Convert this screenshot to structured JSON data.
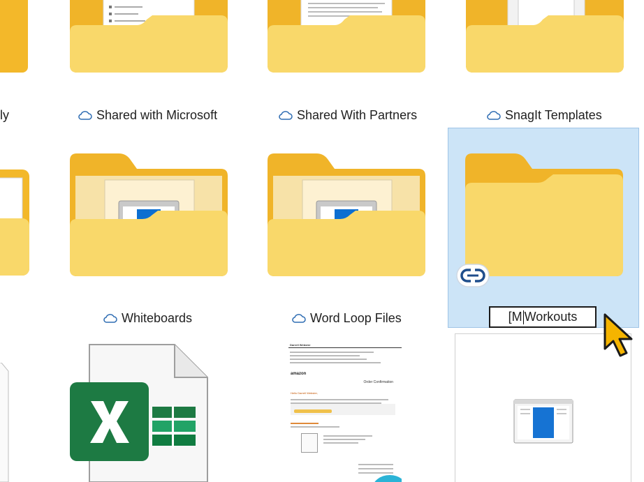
{
  "labels": {
    "partial_left_1": "ly",
    "shared_with_microsoft": "Shared with Microsoft",
    "shared_with_partners": "Shared With Partners",
    "snagit_templates": "SnagIt Templates",
    "whiteboards": "Whiteboards",
    "word_loop_files": "Word Loop Files"
  },
  "rename": {
    "before_caret": "[M",
    "after_caret": "Workouts"
  },
  "email_preview": {
    "header": "Darrell Webster",
    "brand": "amazon",
    "title": "Order Confirmation",
    "greeting": "Hello Darrell Webster,"
  },
  "icons": {
    "cloud": "cloud-icon",
    "link": "link-icon",
    "cursor": "cursor-arrow-icon",
    "excel": "excel-file-icon"
  },
  "colors": {
    "folder_back": "#f3b82a",
    "folder_front": "#f9d86a",
    "selection": "#cce4f7",
    "excel_green": "#1d7a43",
    "cursor_yellow": "#f5b400"
  }
}
